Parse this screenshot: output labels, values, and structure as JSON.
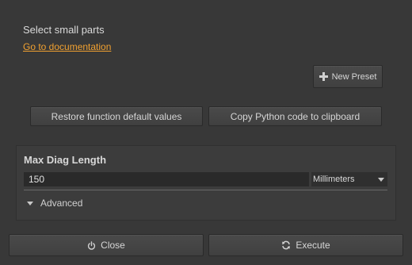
{
  "header": {
    "title": "Select small parts",
    "doc_link": "Go to documentation"
  },
  "preset": {
    "new_label": "New Preset",
    "icon": "plus-icon"
  },
  "actions": {
    "restore_label": "Restore function default values",
    "copy_label": "Copy Python code to clipboard"
  },
  "parameter": {
    "label": "Max Diag Length",
    "value": "150",
    "unit": "Millimeters"
  },
  "advanced": {
    "label": "Advanced"
  },
  "footer": {
    "close_label": "Close",
    "close_icon": "power-icon",
    "execute_label": "Execute",
    "execute_icon": "refresh-icon"
  },
  "colors": {
    "background": "#383838",
    "link": "#f0a030",
    "text": "#d8d8d8"
  }
}
